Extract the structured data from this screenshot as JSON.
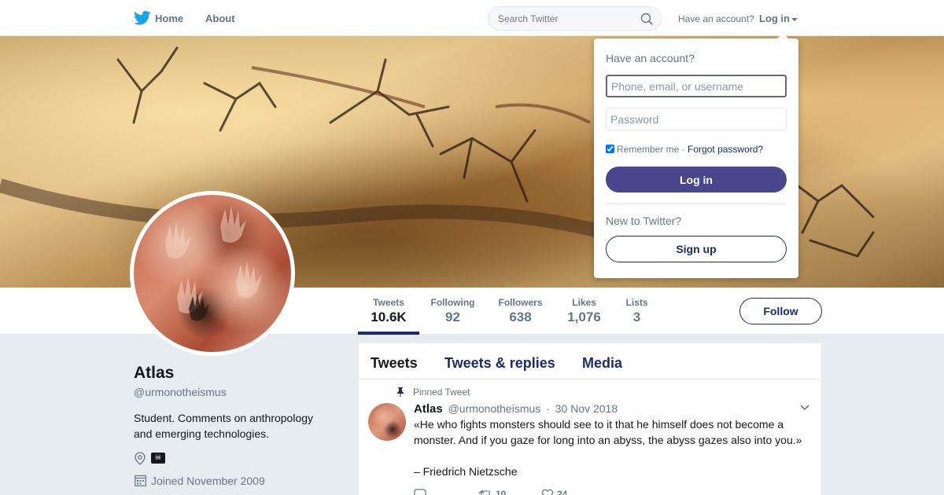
{
  "nav": {
    "home_label": "Home",
    "about_label": "About",
    "search_placeholder": "Search Twitter",
    "have_account": "Have an account?",
    "login_label": "Log in"
  },
  "profile": {
    "name": "Atlas",
    "handle": "@urmonotheismus",
    "bio": "Student. Comments on anthropology and emerging technologies.",
    "location_emoji": "☠",
    "joined": "Joined November 2009",
    "follow_label": "Follow"
  },
  "stats": [
    {
      "label": "Tweets",
      "value": "10.6K"
    },
    {
      "label": "Following",
      "value": "92"
    },
    {
      "label": "Followers",
      "value": "638"
    },
    {
      "label": "Likes",
      "value": "1,076"
    },
    {
      "label": "Lists",
      "value": "3"
    }
  ],
  "timeline": {
    "tabs": [
      "Tweets",
      "Tweets & replies",
      "Media"
    ],
    "pinned_label": "Pinned Tweet",
    "tweet": {
      "name": "Atlas",
      "handle": "@urmonotheismus",
      "separator": "·",
      "date": "30 Nov 2018",
      "text": "«He who fights monsters should see to it that he himself does not become a monster. And if you gaze for long into an abyss, the abyss gazes also into you.»",
      "attribution": "– Friedrich Nietzsche",
      "retweets": "10",
      "likes": "24"
    }
  },
  "login_dropdown": {
    "title": "Have an account?",
    "username_placeholder": "Phone, email, or username",
    "password_placeholder": "Password",
    "remember_label": "Remember me",
    "separator": "·",
    "forgot_label": "Forgot password?",
    "login_button": "Log in",
    "new_label": "New to Twitter?",
    "signup_button": "Sign up"
  },
  "colors": {
    "accent": "#1b2b6d",
    "login_button": "#48468d",
    "twitter_blue": "#1da1f2",
    "page_bg": "#e6ecf0"
  }
}
